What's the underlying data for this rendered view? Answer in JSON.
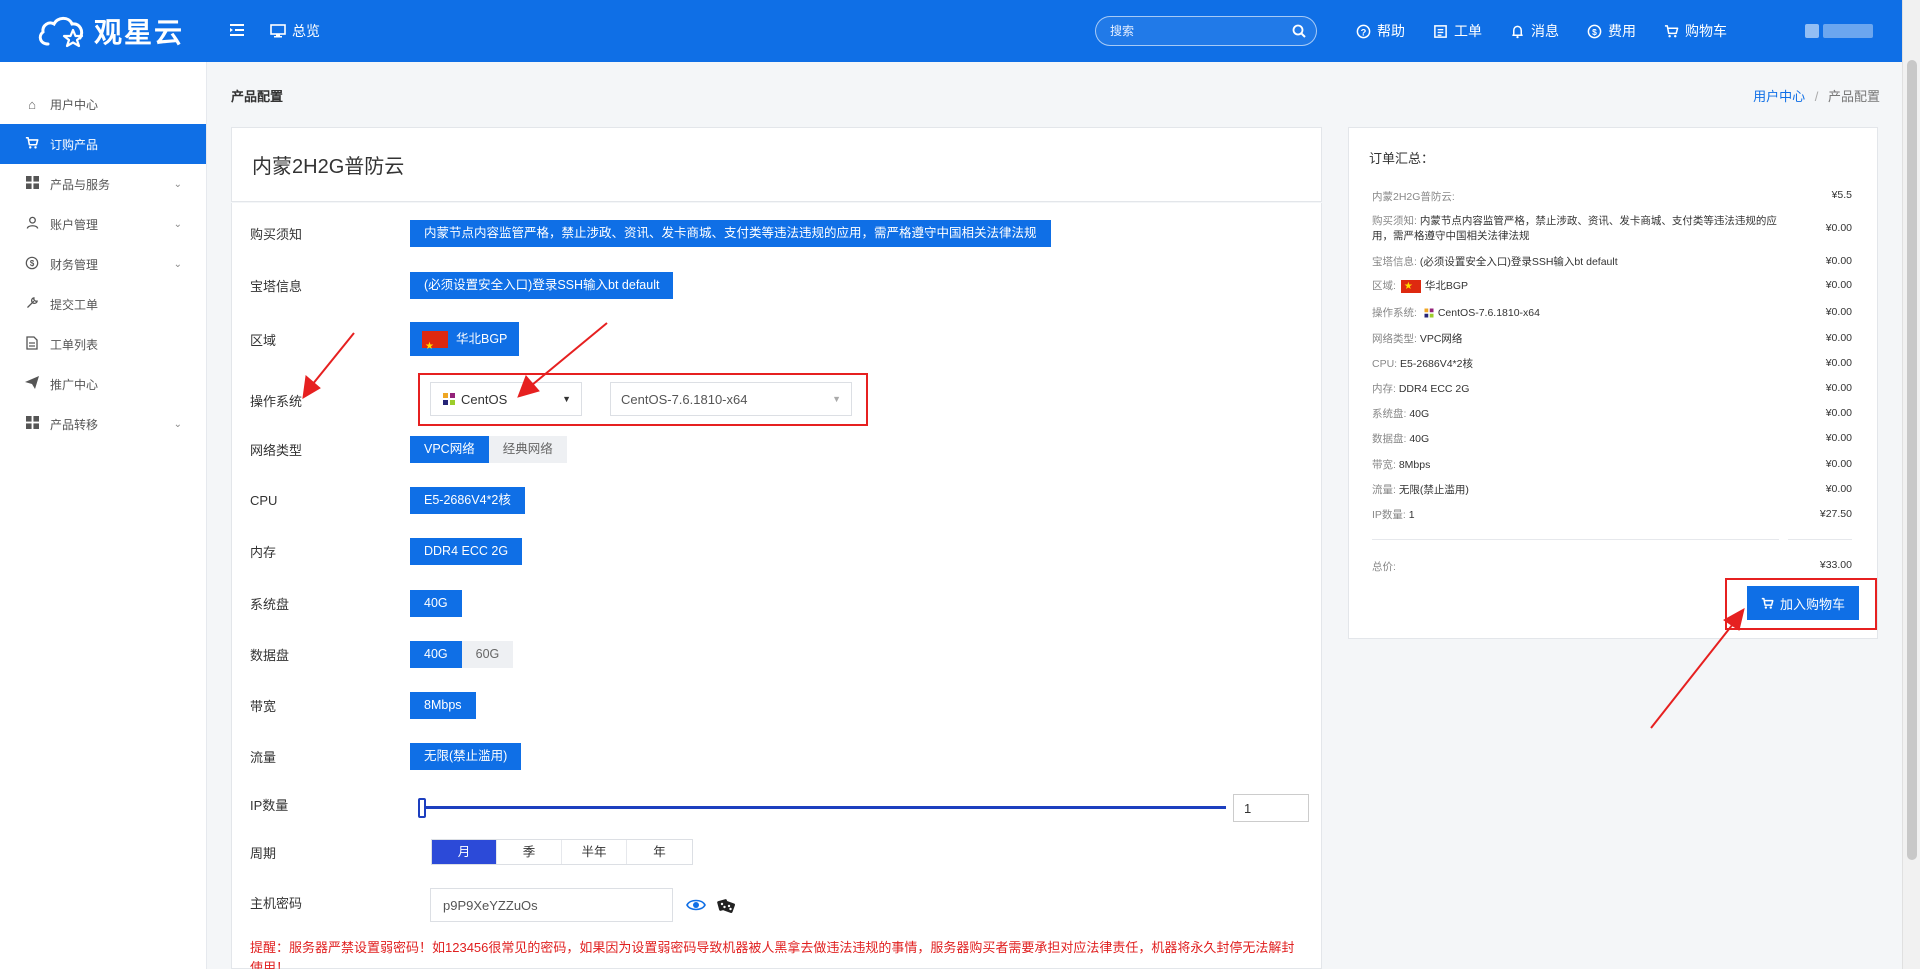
{
  "header": {
    "logo_text": "观星云",
    "overview_label": "总览",
    "search_placeholder": "搜索",
    "links": [
      {
        "label": "帮助",
        "icon": "help-icon"
      },
      {
        "label": "工单",
        "icon": "ticket-icon"
      },
      {
        "label": "消息",
        "icon": "bell-icon"
      },
      {
        "label": "费用",
        "icon": "dollar-icon"
      },
      {
        "label": "购物车",
        "icon": "cart-icon"
      }
    ]
  },
  "sidebar": {
    "items": [
      {
        "label": "用户中心",
        "icon": "home-icon",
        "has_submenu": false
      },
      {
        "label": "订购产品",
        "icon": "cart-icon",
        "has_submenu": false,
        "active": true
      },
      {
        "label": "产品与服务",
        "icon": "grid-icon",
        "has_submenu": true
      },
      {
        "label": "账户管理",
        "icon": "user-icon",
        "has_submenu": true
      },
      {
        "label": "财务管理",
        "icon": "dollar-icon",
        "has_submenu": true
      },
      {
        "label": "提交工单",
        "icon": "wrench-icon",
        "has_submenu": false
      },
      {
        "label": "工单列表",
        "icon": "document-icon",
        "has_submenu": false
      },
      {
        "label": "推广中心",
        "icon": "send-icon",
        "has_submenu": false
      },
      {
        "label": "产品转移",
        "icon": "grid-icon",
        "has_submenu": true
      }
    ]
  },
  "page": {
    "title": "产品配置",
    "breadcrumb": {
      "home": "用户中心",
      "separator": "/",
      "current": "产品配置"
    }
  },
  "product": {
    "name": "内蒙2H2G普防云"
  },
  "config": {
    "notice": {
      "label": "购买须知",
      "value": "内蒙节点内容监管严格，禁止涉政、资讯、发卡商城、支付类等违法违规的应用，需严格遵守中国相关法律法规"
    },
    "panel": {
      "label": "宝塔信息",
      "value": "(必须设置安全入口)登录SSH输入bt default"
    },
    "region": {
      "label": "区域",
      "value": "华北BGP"
    },
    "os": {
      "label": "操作系统",
      "family": "CentOS",
      "version": "CentOS-7.6.1810-x64"
    },
    "network": {
      "label": "网络类型",
      "options": [
        "VPC网络",
        "经典网络"
      ],
      "selected": 0
    },
    "cpu": {
      "label": "CPU",
      "value": "E5-2686V4*2核"
    },
    "memory": {
      "label": "内存",
      "value": "DDR4 ECC 2G"
    },
    "system_disk": {
      "label": "系统盘",
      "value": "40G"
    },
    "data_disk": {
      "label": "数据盘",
      "options": [
        "40G",
        "60G"
      ],
      "selected": 0
    },
    "bandwidth": {
      "label": "带宽",
      "value": "8Mbps"
    },
    "traffic": {
      "label": "流量",
      "value": "无限(禁止滥用)"
    },
    "ip_count": {
      "label": "IP数量",
      "value": "1"
    },
    "cycle": {
      "label": "周期",
      "options": [
        "月",
        "季",
        "半年",
        "年"
      ],
      "selected": 0
    },
    "password": {
      "label": "主机密码",
      "value": "p9P9XeYZZuOs"
    },
    "warning": "提醒：服务器严禁设置弱密码！如123456很常见的密码，如果因为设置弱密码导致机器被人黑拿去做违法违规的事情，服务器购买者需要承担对应法律责任，机器将永久封停无法解封使用！"
  },
  "summary": {
    "title": "订单汇总：",
    "product_line": {
      "name": "内蒙2H2G普防云:",
      "price": "¥5.5"
    },
    "rows": [
      {
        "key": "购买须知:",
        "value": "内蒙节点内容监管严格，禁止涉政、资讯、发卡商城、支付类等违法违规的应用，需严格遵守中国相关法律法规",
        "price": "¥0.00"
      },
      {
        "key": "宝塔信息:",
        "value": "(必须设置安全入口)登录SSH输入bt default",
        "price": "¥0.00"
      },
      {
        "key": "区域:",
        "value": "华北BGP",
        "price": "¥0.00"
      },
      {
        "key": "操作系统:",
        "value": "CentOS-7.6.1810-x64",
        "price": "¥0.00"
      },
      {
        "key": "网络类型:",
        "value": "VPC网络",
        "price": "¥0.00"
      },
      {
        "key": "CPU:",
        "value": "E5-2686V4*2核",
        "price": "¥0.00"
      },
      {
        "key": "内存:",
        "value": "DDR4 ECC 2G",
        "price": "¥0.00"
      },
      {
        "key": "系统盘:",
        "value": "40G",
        "price": "¥0.00"
      },
      {
        "key": "数据盘:",
        "value": "40G",
        "price": "¥0.00"
      },
      {
        "key": "带宽:",
        "value": "8Mbps",
        "price": "¥0.00"
      },
      {
        "key": "流量:",
        "value": "无限(禁止滥用)",
        "price": "¥0.00"
      },
      {
        "key": "IP数量:",
        "value": "1",
        "price": "¥27.50"
      }
    ],
    "total": {
      "key": "总价:",
      "price": "¥33.00"
    },
    "add_to_cart": "加入购物车"
  },
  "colors": {
    "primary": "#0f6fe6",
    "cycle_active": "#2c4ad8",
    "annotation": "#e62020",
    "warning": "#e02020"
  }
}
